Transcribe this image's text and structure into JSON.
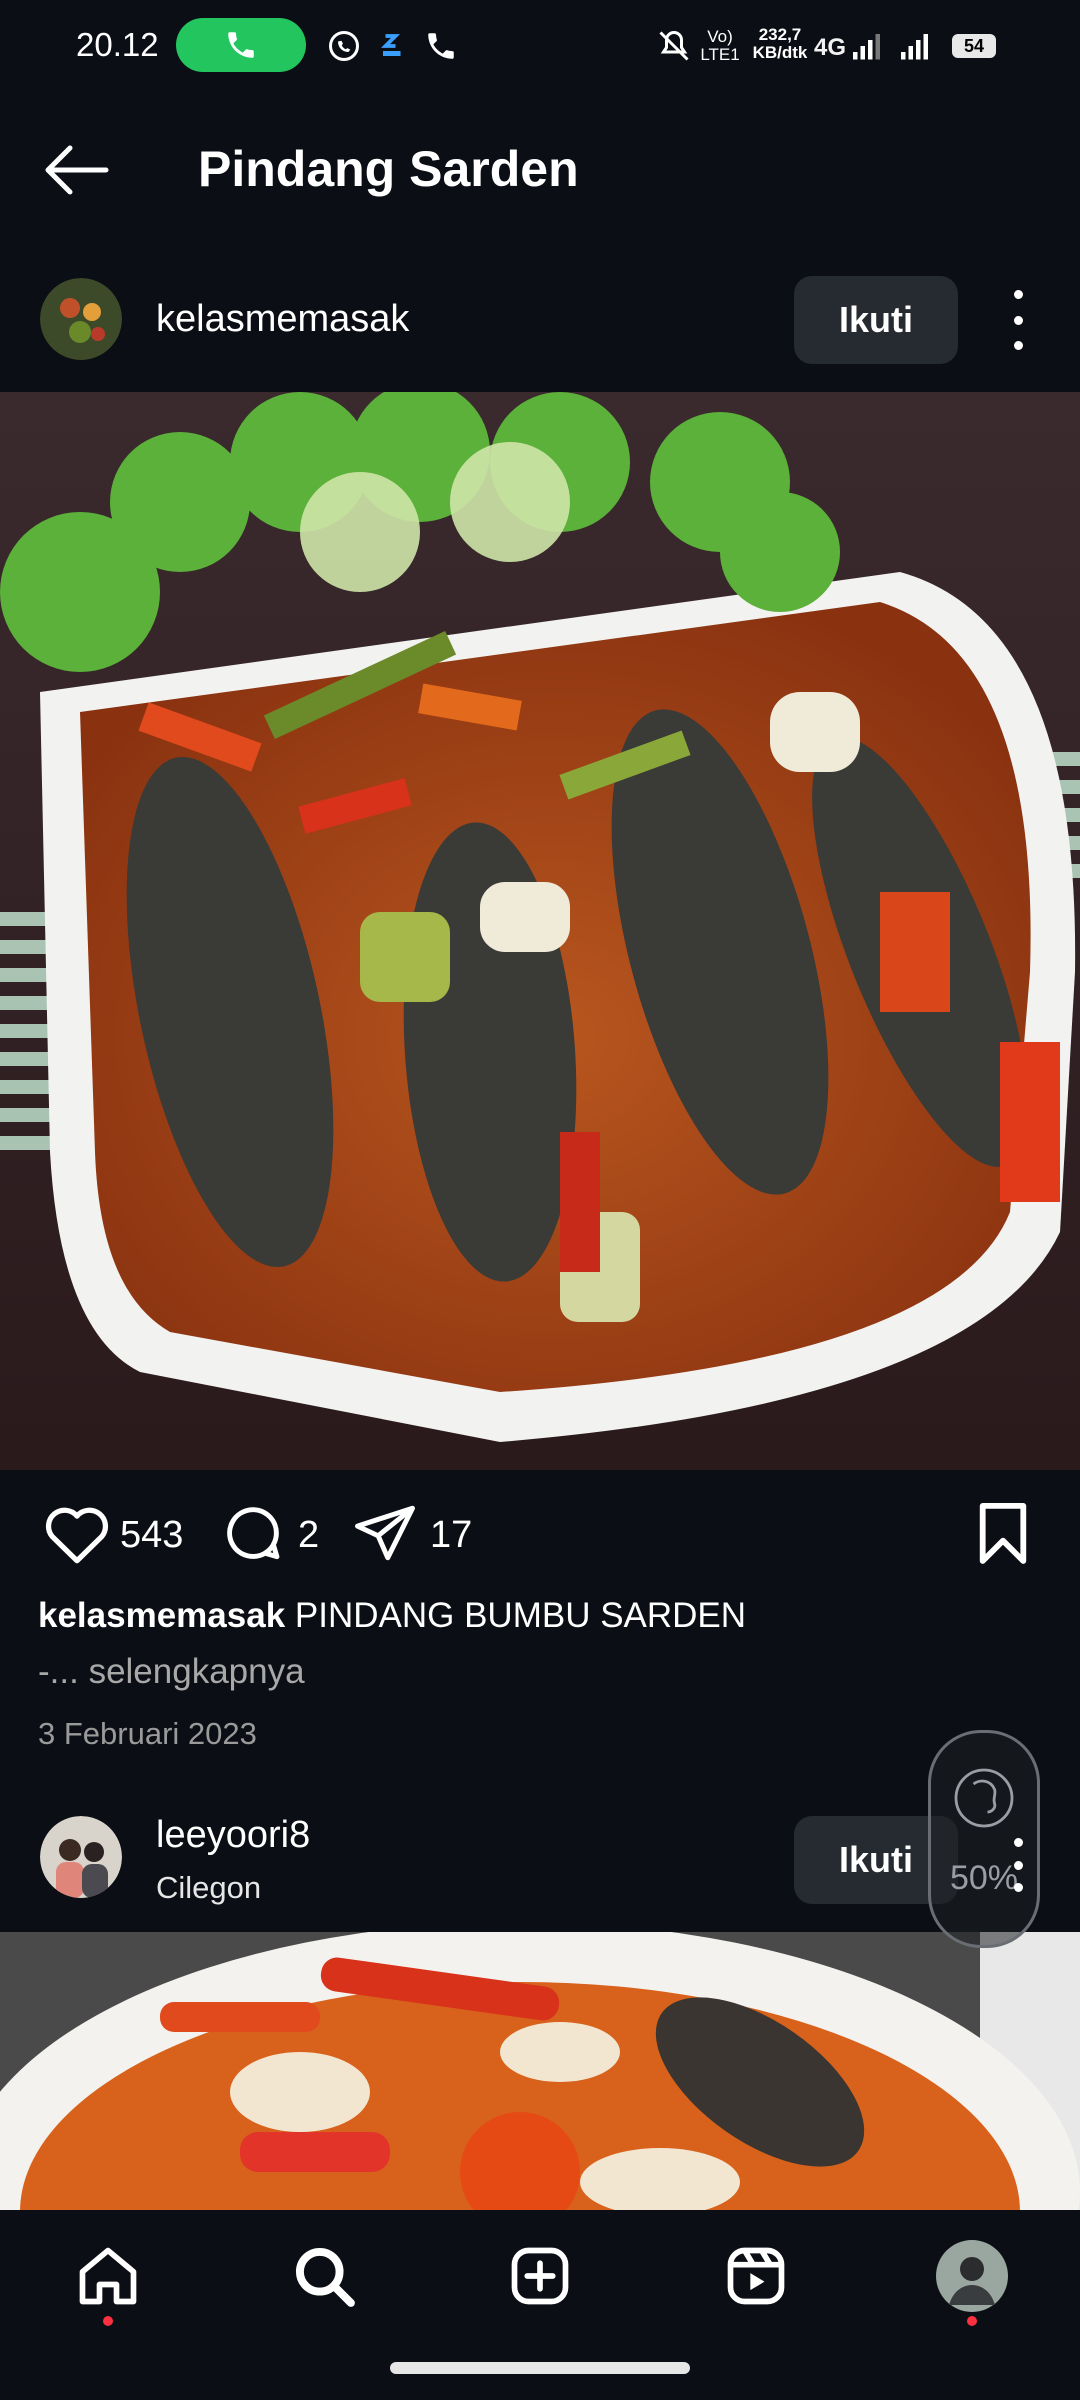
{
  "status_bar": {
    "time": "20.12",
    "network_line1": "Vo)",
    "network_line2": "LTE1",
    "speed_value": "232,7",
    "speed_unit": "KB/dtk",
    "network_type": "4G",
    "battery": "54"
  },
  "header": {
    "title": "Pindang Sarden"
  },
  "post1": {
    "username": "kelasmemasak",
    "follow_label": "Ikuti",
    "likes": "543",
    "comments": "2",
    "shares": "17",
    "caption_user": "kelasmemasak",
    "caption_text": " PINDANG BUMBU SARDEN",
    "caption_more_prefix": "-... ",
    "caption_more_link": "selengkapnya",
    "date": "3 Februari 2023"
  },
  "post2": {
    "username": "leeyoori8",
    "location": "Cilegon",
    "follow_label": "Ikuti"
  },
  "float_widget": {
    "percent": "50%"
  },
  "icons": {
    "back": "arrow-left-icon",
    "like": "heart-icon",
    "comment": "comment-bubble-icon",
    "share": "paper-plane-icon",
    "save": "bookmark-icon",
    "home": "home-icon",
    "search": "search-icon",
    "create": "plus-square-icon",
    "reels": "reels-icon",
    "profile": "profile-avatar"
  },
  "colors": {
    "background": "#0b0e14",
    "follow_button": "#262a31",
    "call_pill": "#22c55e",
    "notification_dot": "#ff3040"
  }
}
